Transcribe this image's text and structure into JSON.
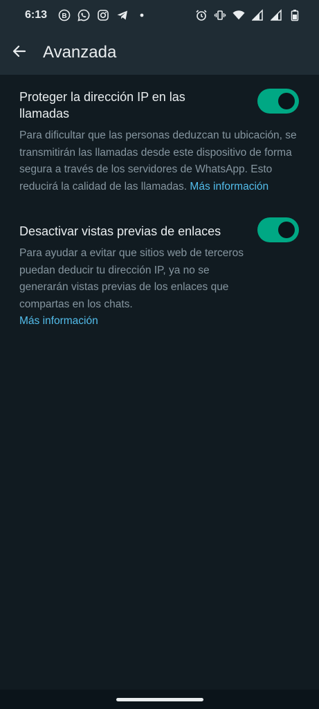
{
  "status_bar": {
    "time": "6:13",
    "left_icons": [
      "b-badge-icon",
      "whatsapp-icon",
      "instagram-icon",
      "telegram-icon",
      "dot-icon"
    ],
    "right_icons": [
      "alarm-icon",
      "vibrate-icon",
      "wifi-icon",
      "signal-icon",
      "signal-icon",
      "battery-icon"
    ]
  },
  "header": {
    "back_icon": "arrow-left-icon",
    "title": "Avanzada"
  },
  "settings": [
    {
      "title": "Proteger la dirección IP en las llamadas",
      "description": "Para dificultar que las personas deduzcan tu ubicación, se transmitirán las llamadas desde este dispositivo de forma segura a través de los servidores de WhatsApp. Esto reducirá la calidad de las llamadas.",
      "link": "Más información",
      "enabled": true
    },
    {
      "title": "Desactivar vistas previas de enlaces",
      "description": "Para ayudar a evitar que sitios web de terceros puedan deducir tu dirección IP, ya no se generarán vistas previas de los enlaces que compartas en los chats.",
      "link": "Más información",
      "enabled": true
    }
  ],
  "colors": {
    "background": "#111b21",
    "app_bar": "#1f2c34",
    "accent": "#00a884",
    "link": "#53bdeb",
    "secondary_text": "#8696a0"
  }
}
